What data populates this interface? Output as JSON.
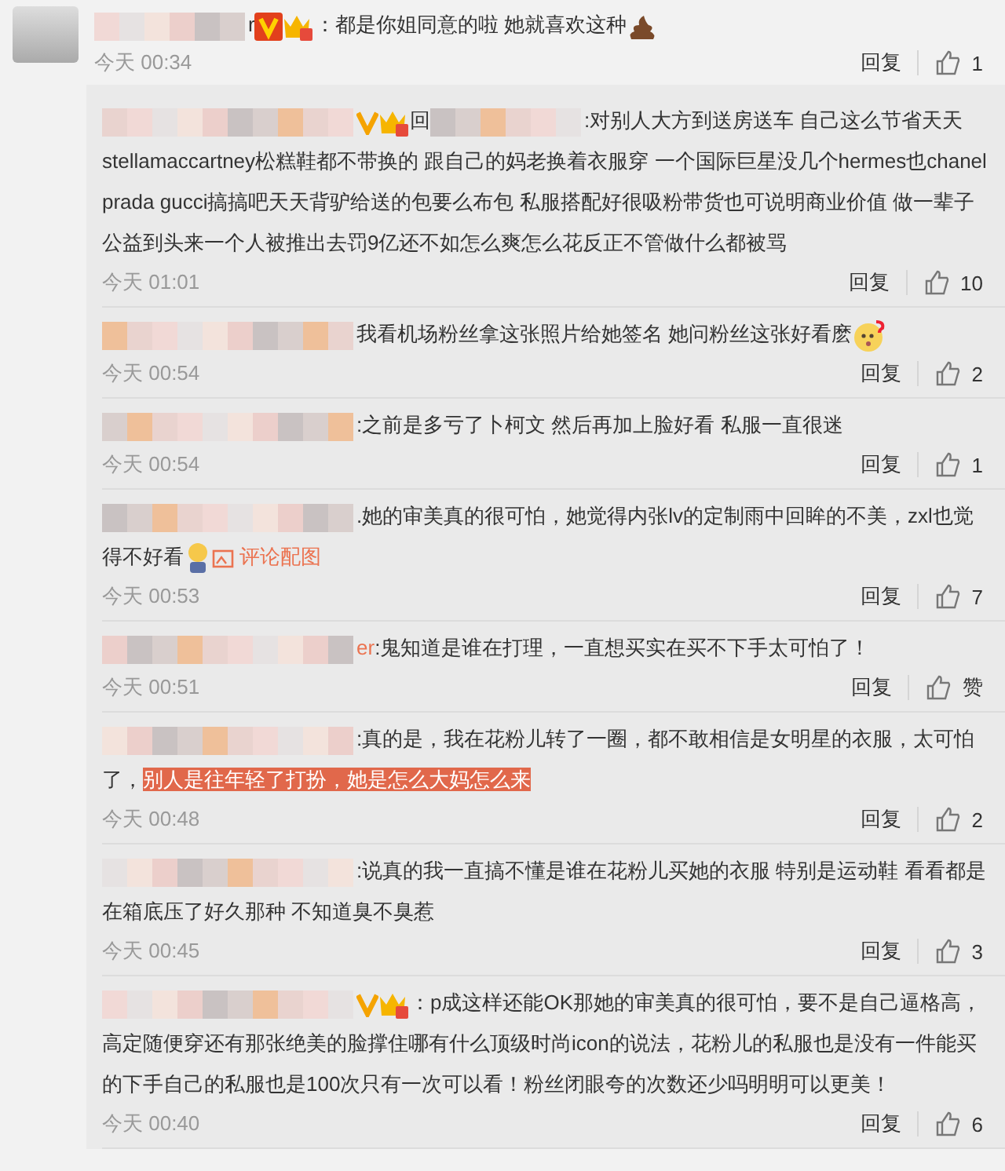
{
  "comments": [
    {
      "kind": "top",
      "name_tail": "r",
      "verified": true,
      "crown": true,
      "segments": [
        {
          "kind": "text",
          "text": "：都是你姐同意的啦 她就喜欢这种"
        },
        {
          "kind": "poop"
        }
      ],
      "time": "今天 00:34",
      "reply": "回复",
      "likes": "1"
    },
    {
      "kind": "reply",
      "verified": true,
      "crown": true,
      "reply_prefix": "回",
      "segments": [
        {
          "kind": "text",
          "text": ":对别人大方到送房送车 自己这么节省天天 stellamaccartney松糕鞋都不带换的 跟自己的妈老换着衣服穿 一个国际巨星没几个hermes也chanel prada gucci搞搞吧天天背驴给送的包要么布包 私服搭配好很吸粉带货也可说明商业价值 做一辈子公益到头来一个人被推出去罚9亿还不如怎么爽怎么花反正不管做什么都被骂"
        }
      ],
      "time": "今天 01:01",
      "reply": "回复",
      "likes": "10"
    },
    {
      "kind": "reply",
      "verified": false,
      "crown": false,
      "segments": [
        {
          "kind": "text",
          "text": "我看机场粉丝拿这张照片给她签名 她问粉丝这张好看麽"
        },
        {
          "kind": "puzzled"
        }
      ],
      "time": "今天 00:54",
      "reply": "回复",
      "likes": "2"
    },
    {
      "kind": "reply",
      "verified": false,
      "crown": false,
      "segments": [
        {
          "kind": "text",
          "text": ":之前是多亏了卜柯文 然后再加上脸好看 私服一直很迷"
        }
      ],
      "time": "今天 00:54",
      "reply": "回复",
      "likes": "1"
    },
    {
      "kind": "reply",
      "verified": false,
      "crown": false,
      "segments": [
        {
          "kind": "text",
          "text": ".她的审美真的很可怕，她觉得内张lv的定制雨中回眸的不美，zxl也觉得不好看"
        },
        {
          "kind": "figure"
        },
        {
          "kind": "image-link",
          "text": "评论配图"
        }
      ],
      "time": "今天 00:53",
      "reply": "回复",
      "likes": "7"
    },
    {
      "kind": "reply",
      "verified": false,
      "crown": false,
      "name_tail": "er",
      "segments": [
        {
          "kind": "text",
          "text": ":鬼知道是谁在打理，一直想买实在买不下手太可怕了！"
        }
      ],
      "time": "今天 00:51",
      "reply": "回复",
      "likes": "赞"
    },
    {
      "kind": "reply",
      "verified": false,
      "crown": false,
      "segments": [
        {
          "kind": "text",
          "text": ":真的是，我在花粉儿转了一圈，都不敢相信是女明星的衣服，太可怕了，"
        },
        {
          "kind": "highlight",
          "text": "别人是往年轻了打扮，她是怎么大妈怎么来"
        }
      ],
      "time": "今天 00:48",
      "reply": "回复",
      "likes": "2"
    },
    {
      "kind": "reply",
      "verified": false,
      "crown": false,
      "segments": [
        {
          "kind": "text",
          "text": ":说真的我一直搞不懂是谁在花粉儿买她的衣服 特别是运动鞋 看看都是在箱底压了好久那种 不知道臭不臭惹"
        }
      ],
      "time": "今天 00:45",
      "reply": "回复",
      "likes": "3"
    },
    {
      "kind": "reply",
      "verified": true,
      "crown": true,
      "segments": [
        {
          "kind": "text",
          "text": "：p成这样还能OK那她的审美真的很可怕，要不是自己逼格高，高定随便穿还有那张绝美的脸撑住哪有什么顶级时尚icon的说法，花粉儿的私服也是没有一件能买的下手自己的私服也是100次只有一次可以看！粉丝闭眼夸的次数还少吗明明可以更美！"
        }
      ],
      "time": "今天 00:40",
      "reply": "回复",
      "likes": "6"
    }
  ]
}
